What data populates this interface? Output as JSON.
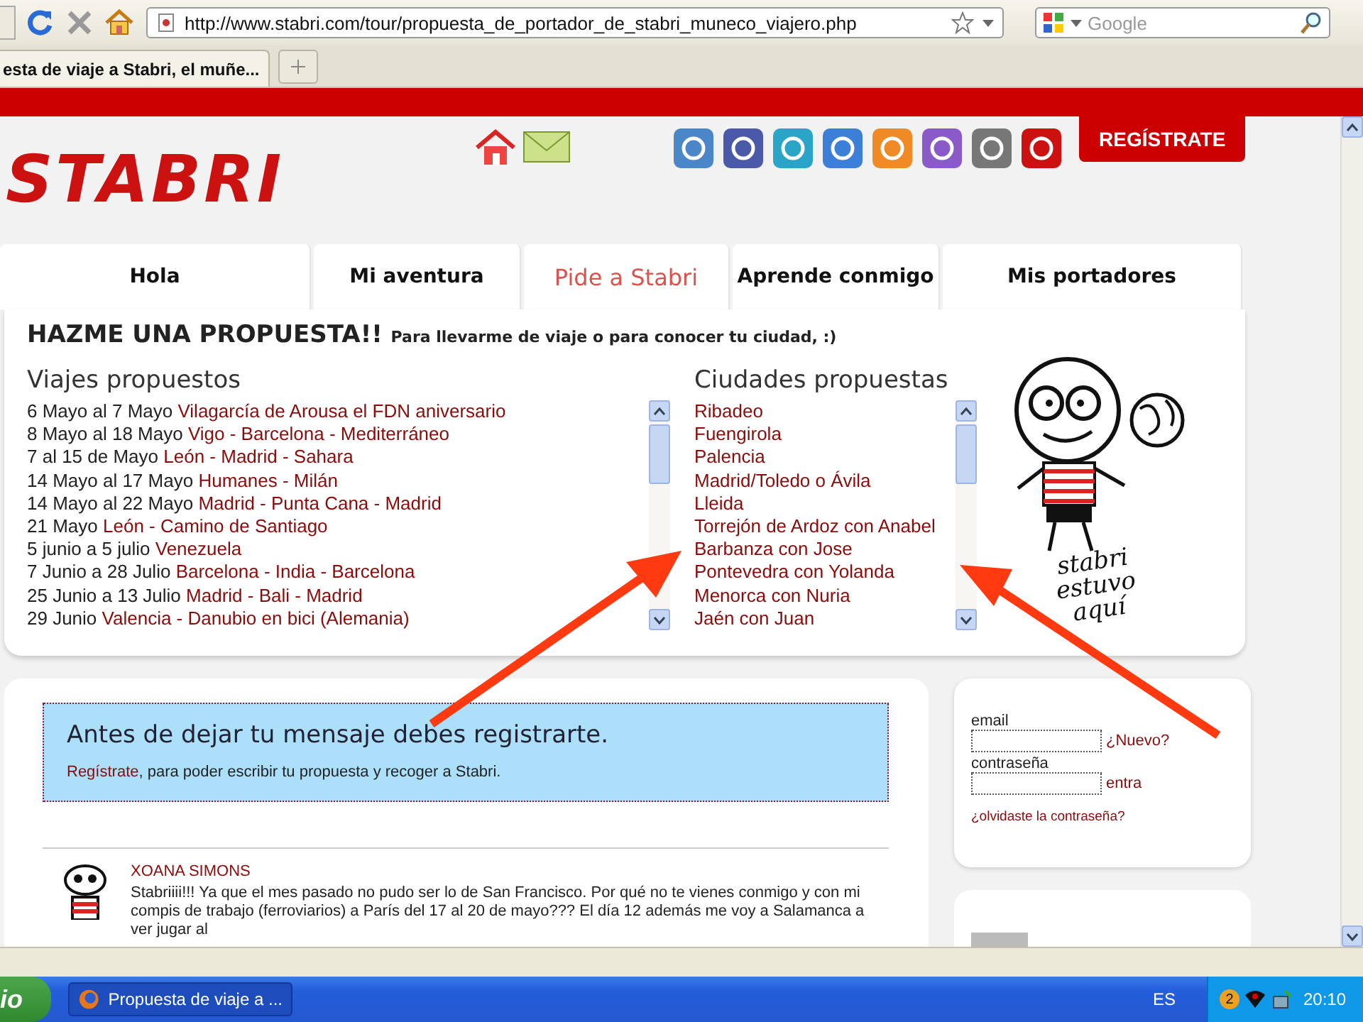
{
  "browser": {
    "url": "http://www.stabri.com/tour/propuesta_de_portador_de_stabri_muneco_viajero.php",
    "search_placeholder": "Google",
    "tab_title": "esta de viaje a Stabri, el muñe..."
  },
  "site": {
    "logo": "STABRI",
    "register_button": "REGÍSTRATE"
  },
  "nav": [
    {
      "label": "Hola",
      "selected": false
    },
    {
      "label": "Mi aventura",
      "selected": false
    },
    {
      "label": "Pide a Stabri",
      "selected": true
    },
    {
      "label": "Aprende conmigo",
      "selected": false
    },
    {
      "label": "Mis portadores",
      "selected": false
    }
  ],
  "proposal": {
    "title": "HAZME UNA PROPUESTA!!",
    "subtitle": "Para llevarme de viaje o para conocer tu ciudad, :)",
    "trips_heading": "Viajes propuestos",
    "trips": [
      {
        "dates": "6 Mayo al 7 Mayo",
        "route": "Vilagarcía de Arousa el FDN aniversario"
      },
      {
        "dates": "8 Mayo al 18 Mayo",
        "route": "Vigo - Barcelona - Mediterráneo"
      },
      {
        "dates": "7 al 15 de Mayo",
        "route": "León - Madrid - Sahara"
      },
      {
        "dates": "14 Mayo al 17 Mayo",
        "route": "Humanes - Milán"
      },
      {
        "dates": "14 Mayo al 22 Mayo",
        "route": "Madrid - Punta Cana - Madrid"
      },
      {
        "dates": "21 Mayo",
        "route": "León - Camino de Santiago"
      },
      {
        "dates": "5 junio a 5 julio",
        "route": "Venezuela"
      },
      {
        "dates": "7 Junio a 28 Julio",
        "route": "Barcelona - India - Barcelona"
      },
      {
        "dates": "25 Junio a 13 Julio",
        "route": "Madrid - Bali - Madrid"
      },
      {
        "dates": "29 Junio",
        "route": "Valencia - Danubio en bici (Alemania)"
      }
    ],
    "cities_heading": "Ciudades propuestas",
    "cities": [
      "Ribadeo",
      "Fuengirola",
      "Palencia",
      "Madrid/Toledo o Ávila",
      "Lleida",
      "Torrejón de Ardoz con Anabel",
      "Barbanza con Jose",
      "Pontevedra con Yolanda",
      "Menorca con Nuria",
      "Jaén con Juan"
    ],
    "mascot_caption": "stabri estuvo aquí"
  },
  "notice": {
    "heading": "Antes de dejar tu mensaje debes registrarte.",
    "link": "Regístrate",
    "text": ", para poder escribir tu propuesta y recoger a Stabri."
  },
  "comments": [
    {
      "author": "XOANA SIMONS",
      "text": "Stabriiii!!! Ya que el mes pasado no pudo ser lo de San Francisco. Por qué no te vienes conmigo y con mi compis de trabajo (ferroviarios) a París del 17 al 20 de mayo??? El día 12 además me voy a Salamanca a ver jugar al"
    }
  ],
  "login": {
    "email_label": "email",
    "new_link": "¿Nuevo?",
    "password_label": "contraseña",
    "enter_link": "entra",
    "forgot_link": "¿olvidaste la contraseña?"
  },
  "taskbar": {
    "start": "io",
    "window": "Propuesta de viaje a ...",
    "language": "ES",
    "tray_badge": "2",
    "clock": "20:10"
  }
}
